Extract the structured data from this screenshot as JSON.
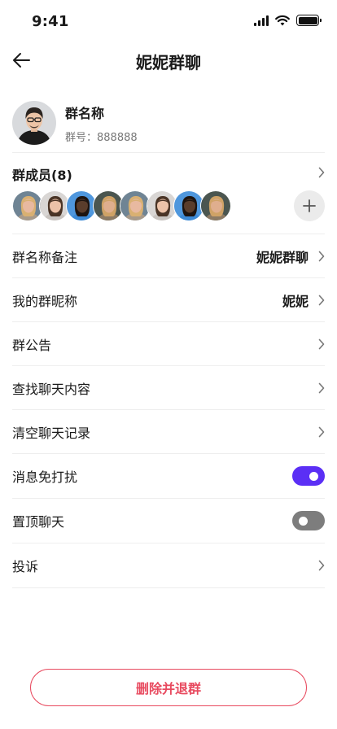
{
  "status_bar": {
    "time": "9:41"
  },
  "nav": {
    "title": "妮妮群聊"
  },
  "group": {
    "name": "群名称",
    "id_text": "群号：888888"
  },
  "members": {
    "title": "群成员(8)",
    "avatars": [
      {
        "name": "member-1",
        "style": "woman-blonde"
      },
      {
        "name": "member-2",
        "style": "man-light"
      },
      {
        "name": "member-3",
        "style": "man-dark-blue"
      },
      {
        "name": "member-4",
        "style": "woman-blonde-dark"
      },
      {
        "name": "member-5",
        "style": "woman-blonde"
      },
      {
        "name": "member-6",
        "style": "man-light"
      },
      {
        "name": "member-7",
        "style": "man-dark-blue"
      },
      {
        "name": "member-8",
        "style": "woman-blonde-dark"
      }
    ]
  },
  "settings": {
    "group_remark": {
      "label": "群名称备注",
      "value": "妮妮群聊"
    },
    "my_nickname": {
      "label": "我的群昵称",
      "value": "妮妮"
    },
    "announcement": {
      "label": "群公告"
    },
    "search_chat": {
      "label": "查找聊天内容"
    },
    "clear_chat": {
      "label": "清空聊天记录"
    },
    "do_not_disturb": {
      "label": "消息免打扰",
      "enabled": true
    },
    "pin_chat": {
      "label": "置顶聊天",
      "enabled": false
    },
    "report": {
      "label": "投诉"
    }
  },
  "actions": {
    "delete_label": "删除并退群"
  },
  "colors": {
    "accent": "#5b2ff5",
    "danger": "#e84a5f",
    "toggle_off": "#7d7d7d"
  }
}
